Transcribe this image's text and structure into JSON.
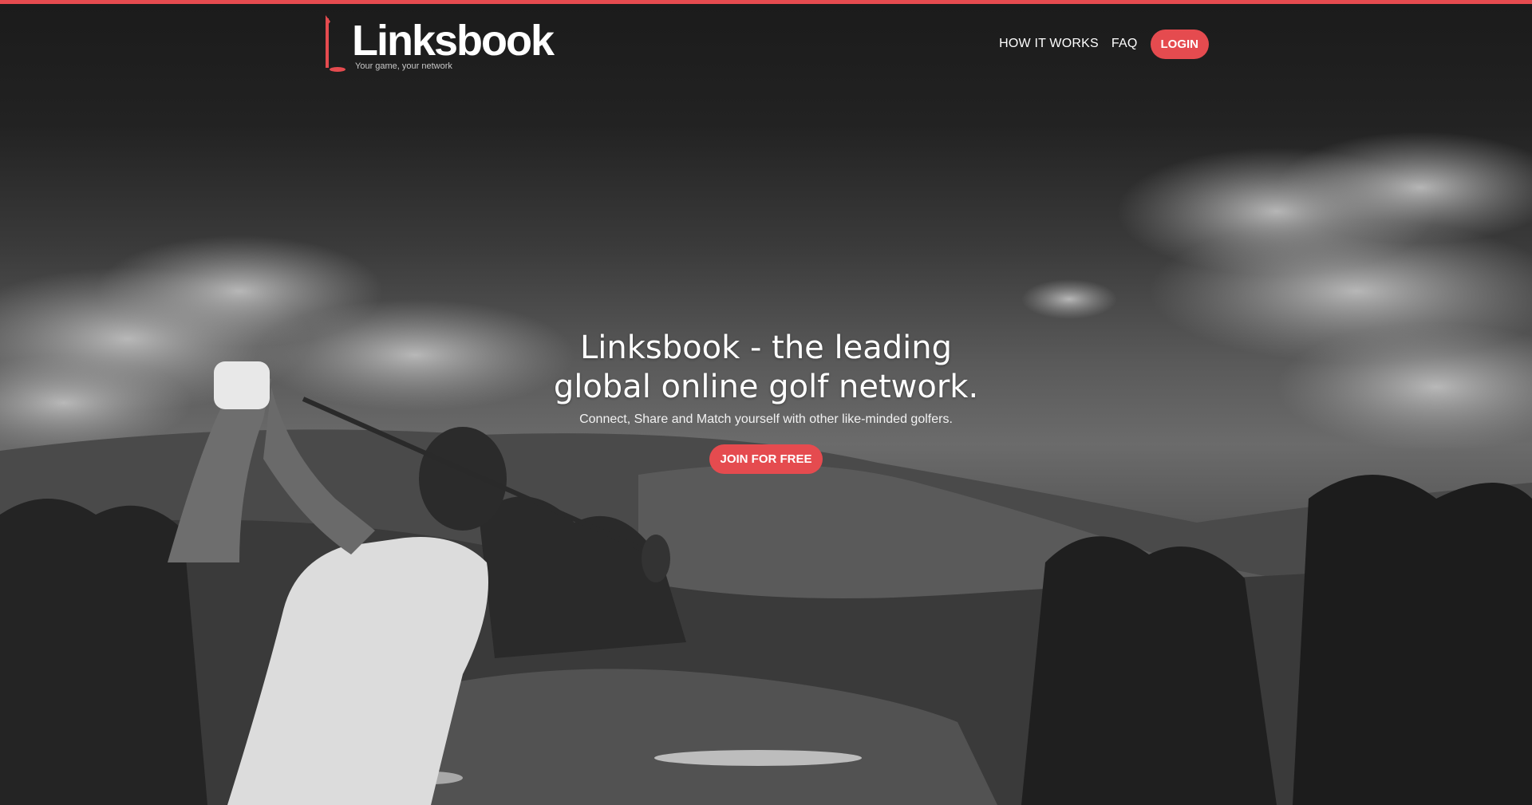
{
  "brand": {
    "name": "Linksbook",
    "tagline": "Your game, your network",
    "accent_color": "#e54b4f"
  },
  "nav": {
    "items": [
      {
        "label": "HOW IT WORKS"
      },
      {
        "label": "FAQ"
      }
    ],
    "login_label": "LOGIN"
  },
  "hero": {
    "title_line1": "Linksbook - the leading",
    "title_line2": "global online golf network.",
    "subtitle": "Connect, Share and Match yourself with other like-minded golfers.",
    "cta_label": "JOIN FOR FREE",
    "background": "black-and-white photo of a golfer mid-swing on a highland course"
  }
}
